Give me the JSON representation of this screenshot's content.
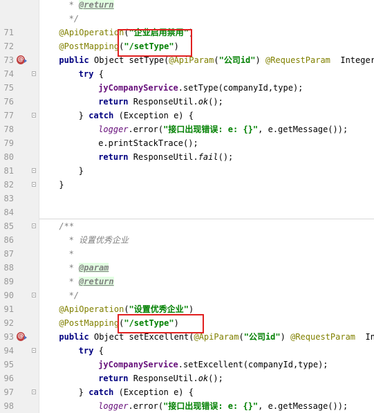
{
  "editor": {
    "lines": [
      {
        "num": "",
        "tokens": [
          {
            "t": "* ",
            "c": "cm"
          },
          {
            "t": "@return",
            "c": "tag"
          }
        ],
        "indent": 3
      },
      {
        "num": "",
        "tokens": [
          {
            "t": "*/",
            "c": "cm"
          }
        ],
        "indent": 3
      },
      {
        "num": "71",
        "tokens": [
          {
            "t": "@ApiOperation",
            "c": "ann"
          },
          {
            "t": "(",
            "c": ""
          },
          {
            "t": "\"企业启用禁用\"",
            "c": "str"
          },
          {
            "t": ")",
            "c": ""
          }
        ],
        "indent": 2
      },
      {
        "num": "72",
        "tokens": [
          {
            "t": "@PostMapping",
            "c": "ann"
          },
          {
            "t": "(",
            "c": ""
          },
          {
            "t": "\"/setType\"",
            "c": "str"
          },
          {
            "t": ")",
            "c": ""
          }
        ],
        "indent": 2
      },
      {
        "num": "73",
        "marker": true,
        "tokens": [
          {
            "t": "public ",
            "c": "kw"
          },
          {
            "t": "Object setType(",
            "c": ""
          },
          {
            "t": "@ApiParam",
            "c": "ann"
          },
          {
            "t": "(",
            "c": ""
          },
          {
            "t": "\"公司id\"",
            "c": "str"
          },
          {
            "t": ") ",
            "c": ""
          },
          {
            "t": "@RequestParam",
            "c": "ann"
          },
          {
            "t": "  Integer",
            "c": ""
          }
        ],
        "indent": 2
      },
      {
        "num": "74",
        "fold": true,
        "tokens": [
          {
            "t": "try ",
            "c": "kw"
          },
          {
            "t": "{",
            "c": ""
          }
        ],
        "indent": 4
      },
      {
        "num": "75",
        "tokens": [
          {
            "t": "jyCompanyService",
            "c": "fld"
          },
          {
            "t": ".setType(companyId,type);",
            "c": ""
          }
        ],
        "indent": 6
      },
      {
        "num": "76",
        "tokens": [
          {
            "t": "return ",
            "c": "kw"
          },
          {
            "t": "ResponseUtil.",
            "c": ""
          },
          {
            "t": "ok",
            "c": "it"
          },
          {
            "t": "();",
            "c": ""
          }
        ],
        "indent": 6
      },
      {
        "num": "77",
        "fold": true,
        "tokens": [
          {
            "t": "} ",
            "c": ""
          },
          {
            "t": "catch ",
            "c": "kw"
          },
          {
            "t": "(Exception e) {",
            "c": ""
          }
        ],
        "indent": 4
      },
      {
        "num": "78",
        "tokens": [
          {
            "t": "logger",
            "c": "log"
          },
          {
            "t": ".error(",
            "c": ""
          },
          {
            "t": "\"接口出现错误: e: {}\"",
            "c": "str"
          },
          {
            "t": ", e.getMessage());",
            "c": ""
          }
        ],
        "indent": 6
      },
      {
        "num": "79",
        "tokens": [
          {
            "t": "e.printStackTrace();",
            "c": ""
          }
        ],
        "indent": 6
      },
      {
        "num": "80",
        "tokens": [
          {
            "t": "return ",
            "c": "kw"
          },
          {
            "t": "ResponseUtil.",
            "c": ""
          },
          {
            "t": "fail",
            "c": "it"
          },
          {
            "t": "();",
            "c": ""
          }
        ],
        "indent": 6
      },
      {
        "num": "81",
        "fold": true,
        "tokens": [
          {
            "t": "}",
            "c": ""
          }
        ],
        "indent": 4
      },
      {
        "num": "82",
        "fold": true,
        "tokens": [
          {
            "t": "}",
            "c": ""
          }
        ],
        "indent": 2
      },
      {
        "num": "83",
        "tokens": [],
        "indent": 0
      },
      {
        "num": "84",
        "tokens": [],
        "indent": 0
      },
      {
        "num": "85",
        "fold": true,
        "tokens": [
          {
            "t": "/**",
            "c": "cm"
          }
        ],
        "indent": 2
      },
      {
        "num": "86",
        "tokens": [
          {
            "t": "* 设置优秀企业",
            "c": "cm"
          }
        ],
        "indent": 3
      },
      {
        "num": "87",
        "tokens": [
          {
            "t": "*",
            "c": "cm"
          }
        ],
        "indent": 3
      },
      {
        "num": "88",
        "tokens": [
          {
            "t": "* ",
            "c": "cm"
          },
          {
            "t": "@param",
            "c": "tag"
          }
        ],
        "indent": 3
      },
      {
        "num": "89",
        "tokens": [
          {
            "t": "* ",
            "c": "cm"
          },
          {
            "t": "@return",
            "c": "tag"
          }
        ],
        "indent": 3
      },
      {
        "num": "90",
        "fold": true,
        "tokens": [
          {
            "t": "*/",
            "c": "cm"
          }
        ],
        "indent": 3
      },
      {
        "num": "91",
        "tokens": [
          {
            "t": "@ApiOperation",
            "c": "ann"
          },
          {
            "t": "(",
            "c": ""
          },
          {
            "t": "\"设置优秀企业\"",
            "c": "str"
          },
          {
            "t": ")",
            "c": ""
          }
        ],
        "indent": 2
      },
      {
        "num": "92",
        "tokens": [
          {
            "t": "@PostMapping",
            "c": "ann"
          },
          {
            "t": "(",
            "c": ""
          },
          {
            "t": "\"/setType\"",
            "c": "str"
          },
          {
            "t": ")",
            "c": ""
          }
        ],
        "indent": 2
      },
      {
        "num": "93",
        "marker": true,
        "tokens": [
          {
            "t": "public ",
            "c": "kw"
          },
          {
            "t": "Object setExcellent(",
            "c": ""
          },
          {
            "t": "@ApiParam",
            "c": "ann"
          },
          {
            "t": "(",
            "c": ""
          },
          {
            "t": "\"公司id\"",
            "c": "str"
          },
          {
            "t": ") ",
            "c": ""
          },
          {
            "t": "@RequestParam",
            "c": "ann"
          },
          {
            "t": "  Inte",
            "c": ""
          }
        ],
        "indent": 2
      },
      {
        "num": "94",
        "fold": true,
        "tokens": [
          {
            "t": "try ",
            "c": "kw"
          },
          {
            "t": "{",
            "c": ""
          }
        ],
        "indent": 4
      },
      {
        "num": "95",
        "tokens": [
          {
            "t": "jyCompanyService",
            "c": "fld"
          },
          {
            "t": ".setExcellent(companyId,type);",
            "c": ""
          }
        ],
        "indent": 6
      },
      {
        "num": "96",
        "tokens": [
          {
            "t": "return ",
            "c": "kw"
          },
          {
            "t": "ResponseUtil.",
            "c": ""
          },
          {
            "t": "ok",
            "c": "it"
          },
          {
            "t": "();",
            "c": ""
          }
        ],
        "indent": 6
      },
      {
        "num": "97",
        "fold": true,
        "tokens": [
          {
            "t": "} ",
            "c": ""
          },
          {
            "t": "catch ",
            "c": "kw"
          },
          {
            "t": "(Exception e) {",
            "c": ""
          }
        ],
        "indent": 4
      },
      {
        "num": "98",
        "tokens": [
          {
            "t": "logger",
            "c": "log"
          },
          {
            "t": ".error(",
            "c": ""
          },
          {
            "t": "\"接口出现错误: e: {}\"",
            "c": "str"
          },
          {
            "t": ", e.getMessage());",
            "c": ""
          }
        ],
        "indent": 6
      }
    ]
  },
  "colors": {
    "highlight_box": "#e02020",
    "keyword": "#000080",
    "string": "#008000",
    "annotation": "#808000",
    "comment": "#808080"
  }
}
